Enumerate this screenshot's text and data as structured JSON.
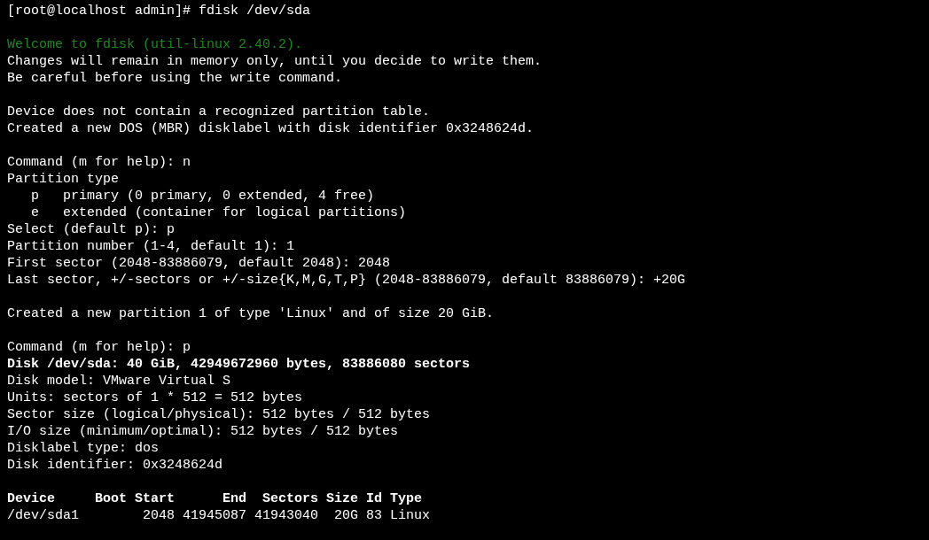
{
  "terminal": {
    "blocks": [
      {
        "lines": [
          {
            "kind": "normal",
            "text": "[root@localhost admin]# fdisk /dev/sda"
          }
        ]
      },
      {
        "lines": [
          {
            "kind": "notice",
            "text": "Welcome to fdisk (util-linux 2.40.2)."
          },
          {
            "kind": "normal",
            "text": "Changes will remain in memory only, until you decide to write them."
          },
          {
            "kind": "normal",
            "text": "Be careful before using the write command."
          }
        ]
      },
      {
        "lines": [
          {
            "kind": "normal",
            "text": "Device does not contain a recognized partition table."
          },
          {
            "kind": "normal",
            "text": "Created a new DOS (MBR) disklabel with disk identifier 0x3248624d."
          }
        ]
      },
      {
        "lines": [
          {
            "kind": "normal",
            "text": "Command (m for help): n"
          },
          {
            "kind": "normal",
            "text": "Partition type"
          },
          {
            "kind": "normal",
            "text": "   p   primary (0 primary, 0 extended, 4 free)"
          },
          {
            "kind": "normal",
            "text": "   e   extended (container for logical partitions)"
          },
          {
            "kind": "normal",
            "text": "Select (default p): p"
          },
          {
            "kind": "normal",
            "text": "Partition number (1-4, default 1): 1"
          },
          {
            "kind": "normal",
            "text": "First sector (2048-83886079, default 2048): 2048"
          },
          {
            "kind": "normal",
            "text": "Last sector, +/-sectors or +/-size{K,M,G,T,P} (2048-83886079, default 83886079): +20G"
          }
        ]
      },
      {
        "lines": [
          {
            "kind": "normal",
            "text": "Created a new partition 1 of type 'Linux' and of size 20 GiB."
          }
        ]
      },
      {
        "lines": [
          {
            "kind": "normal",
            "text": "Command (m for help): p"
          },
          {
            "kind": "bold",
            "text": "Disk /dev/sda: 40 GiB, 42949672960 bytes, 83886080 sectors"
          },
          {
            "kind": "normal",
            "text": "Disk model: VMware Virtual S"
          },
          {
            "kind": "normal",
            "text": "Units: sectors of 1 * 512 = 512 bytes"
          },
          {
            "kind": "normal",
            "text": "Sector size (logical/physical): 512 bytes / 512 bytes"
          },
          {
            "kind": "normal",
            "text": "I/O size (minimum/optimal): 512 bytes / 512 bytes"
          },
          {
            "kind": "normal",
            "text": "Disklabel type: dos"
          },
          {
            "kind": "normal",
            "text": "Disk identifier: 0x3248624d"
          }
        ]
      },
      {
        "lines": [
          {
            "kind": "bold",
            "text": "Device     Boot Start      End  Sectors Size Id Type"
          },
          {
            "kind": "normal",
            "text": "/dev/sda1        2048 41945087 41943040  20G 83 Linux"
          }
        ]
      }
    ]
  }
}
